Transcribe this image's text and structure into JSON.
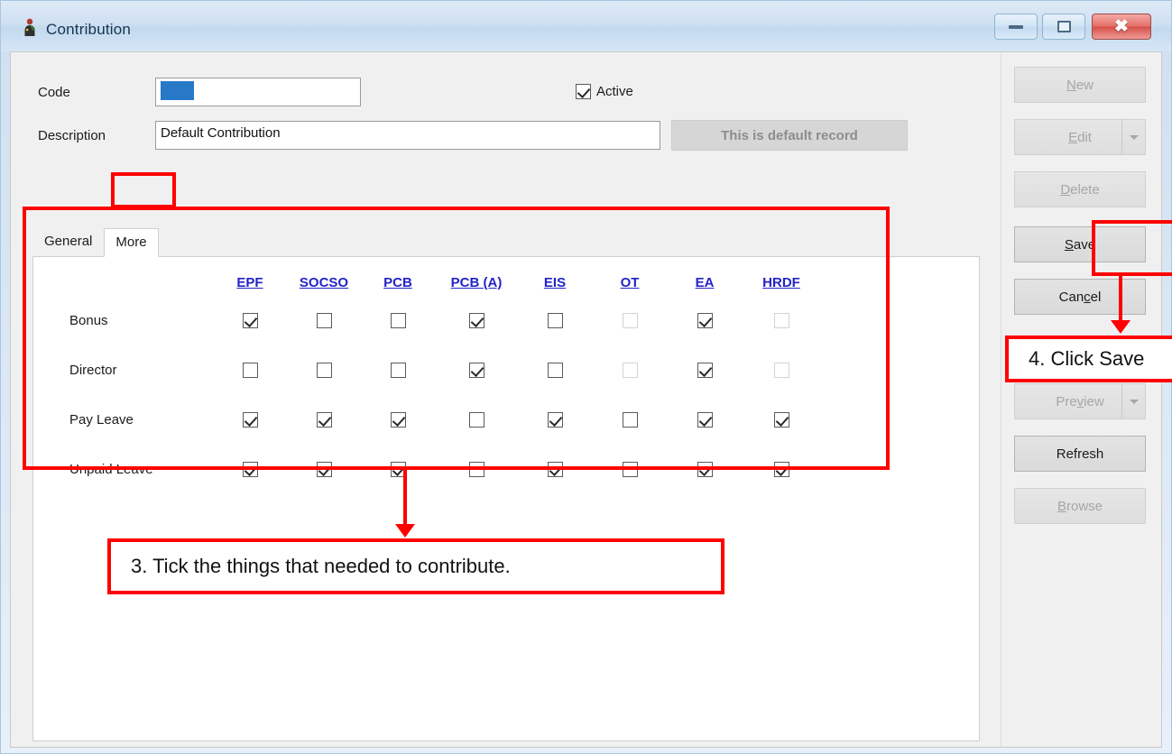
{
  "window": {
    "title": "Contribution",
    "icon": "app-icon",
    "controls": {
      "minimize": "minimize-icon",
      "maximize": "maximize-icon",
      "close": "close-icon"
    }
  },
  "form": {
    "code_label": "Code",
    "code_value": "",
    "description_label": "Description",
    "description_value": "Default Contribution",
    "active_label": "Active",
    "active_checked": true,
    "default_record_button": "This is default record"
  },
  "tabs": [
    {
      "label": "General",
      "active": false
    },
    {
      "label": "More",
      "active": true
    }
  ],
  "table": {
    "columns": [
      "EPF",
      "SOCSO",
      "PCB",
      "PCB (A)",
      "EIS",
      "OT",
      "EA",
      "HRDF"
    ],
    "rows": [
      {
        "label": "Bonus",
        "values": [
          true,
          false,
          false,
          true,
          false,
          false,
          true,
          false
        ],
        "disabled": [
          false,
          false,
          false,
          false,
          false,
          true,
          false,
          true
        ]
      },
      {
        "label": "Director",
        "values": [
          false,
          false,
          false,
          true,
          false,
          false,
          true,
          false
        ],
        "disabled": [
          false,
          false,
          false,
          false,
          false,
          true,
          false,
          true
        ]
      },
      {
        "label": "Pay Leave",
        "values": [
          true,
          true,
          true,
          false,
          true,
          false,
          true,
          true
        ],
        "disabled": [
          false,
          false,
          false,
          false,
          false,
          false,
          false,
          false
        ]
      },
      {
        "label": "Unpaid Leave",
        "values": [
          true,
          true,
          true,
          false,
          true,
          false,
          true,
          true
        ],
        "disabled": [
          false,
          false,
          false,
          false,
          false,
          false,
          false,
          false
        ]
      }
    ]
  },
  "buttons": [
    {
      "id": "new",
      "label": "New",
      "accel": "N",
      "enabled": false,
      "dropdown": false
    },
    {
      "id": "edit",
      "label": "Edit",
      "accel": "E",
      "enabled": false,
      "dropdown": true
    },
    {
      "id": "delete",
      "label": "Delete",
      "accel": "D",
      "enabled": false,
      "dropdown": false
    },
    {
      "id": "save",
      "label": "Save",
      "accel": "S",
      "enabled": true,
      "dropdown": false
    },
    {
      "id": "cancel",
      "label": "Cancel",
      "accel": "c",
      "enabled": true,
      "dropdown": false
    },
    {
      "id": "preview",
      "label": "Preview",
      "accel": "v",
      "enabled": false,
      "dropdown": true
    },
    {
      "id": "refresh",
      "label": "Refresh",
      "accel": "",
      "enabled": true,
      "dropdown": false
    },
    {
      "id": "browse",
      "label": "Browse",
      "accel": "B",
      "enabled": false,
      "dropdown": false
    }
  ],
  "splitter": {
    "arrow": ">"
  },
  "annotations": {
    "step3": "3. Tick the things that needed to contribute.",
    "step4": "4. Click Save",
    "highlight_color": "#ff0000"
  }
}
